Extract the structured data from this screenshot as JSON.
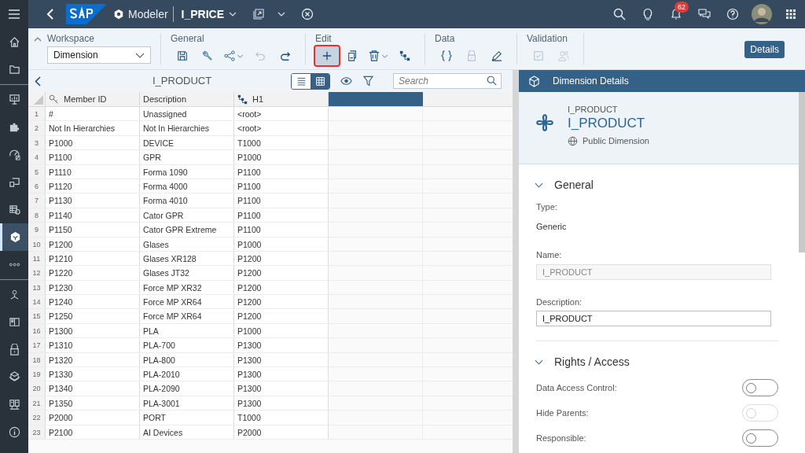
{
  "shell": {
    "product": "Modeler",
    "document": "I_PRICE",
    "notification_count": "62"
  },
  "sidebar": {
    "items": [
      {
        "kind": "home",
        "selected": false
      },
      {
        "kind": "folder",
        "selected": false
      },
      {
        "kind": "board",
        "selected": false
      },
      {
        "kind": "puzzle",
        "selected": false
      },
      {
        "kind": "gauge",
        "selected": false
      },
      {
        "kind": "card",
        "selected": false
      },
      {
        "kind": "table",
        "selected": false
      },
      {
        "kind": "cube",
        "selected": true
      },
      {
        "kind": "more",
        "selected": false
      },
      {
        "kind": "network",
        "selected": false
      },
      {
        "kind": "book",
        "selected": false
      },
      {
        "kind": "lock",
        "selected": false
      },
      {
        "kind": "boxes",
        "selected": false
      },
      {
        "kind": "servers",
        "selected": false
      },
      {
        "kind": "info",
        "selected": false
      }
    ]
  },
  "toolbar": {
    "workspace": {
      "label": "Workspace",
      "value": "Dimension"
    },
    "groups": [
      {
        "label": "General",
        "buttons": [
          {
            "kind": "save",
            "disabled": false,
            "menu": false,
            "selected": false
          },
          {
            "kind": "wrench",
            "disabled": false,
            "menu": false,
            "selected": false
          },
          {
            "kind": "share",
            "disabled": false,
            "menu": true,
            "selected": false
          },
          {
            "kind": "undo",
            "disabled": true,
            "menu": false,
            "selected": false
          },
          {
            "kind": "redo",
            "disabled": false,
            "menu": false,
            "selected": false
          }
        ]
      },
      {
        "label": "Edit",
        "buttons": [
          {
            "kind": "add",
            "disabled": false,
            "menu": false,
            "selected": true
          },
          {
            "kind": "copy",
            "disabled": false,
            "menu": false,
            "selected": false
          },
          {
            "kind": "delete",
            "disabled": false,
            "menu": true,
            "selected": false
          },
          {
            "kind": "hierarchy",
            "disabled": false,
            "menu": false,
            "selected": false
          }
        ]
      },
      {
        "label": "Data",
        "buttons": [
          {
            "kind": "braces",
            "disabled": false,
            "menu": false,
            "selected": false
          },
          {
            "kind": "lock",
            "disabled": true,
            "menu": false,
            "selected": false
          },
          {
            "kind": "pen",
            "disabled": false,
            "menu": false,
            "selected": false
          }
        ]
      },
      {
        "label": "Validation",
        "buttons": [
          {
            "kind": "check",
            "disabled": true,
            "menu": false,
            "selected": false
          },
          {
            "kind": "users",
            "disabled": true,
            "menu": false,
            "selected": false
          }
        ]
      }
    ],
    "details_button": "Details"
  },
  "grid": {
    "title": "I_PRODUCT",
    "views": [
      {
        "kind": "list",
        "selected": false
      },
      {
        "kind": "grid",
        "selected": true
      }
    ],
    "search": {
      "placeholder": "Search"
    },
    "columns": [
      {
        "label": "Member ID",
        "kind": "key"
      },
      {
        "label": "Description",
        "kind": "plain"
      },
      {
        "label": "H1",
        "kind": "hierarchy"
      }
    ],
    "rows": [
      {
        "number": "1",
        "cells": [
          "#",
          "Unassigned",
          "<root>"
        ]
      },
      {
        "number": "2",
        "cells": [
          "Not In Hierarchies",
          "Not In Hierarchies",
          "<root>"
        ]
      },
      {
        "number": "3",
        "cells": [
          "P1000",
          "DEVICE",
          "T1000"
        ]
      },
      {
        "number": "4",
        "cells": [
          "P1100",
          "GPR",
          "P1000"
        ]
      },
      {
        "number": "5",
        "cells": [
          "P1110",
          "Forma 1090",
          "P1100"
        ]
      },
      {
        "number": "6",
        "cells": [
          "P1120",
          "Forma 4000",
          "P1100"
        ]
      },
      {
        "number": "7",
        "cells": [
          "P1130",
          "Forma 4010",
          "P1100"
        ]
      },
      {
        "number": "8",
        "cells": [
          "P1140",
          "Cator GPR",
          "P1100"
        ]
      },
      {
        "number": "9",
        "cells": [
          "P1150",
          "Cator GPR Extreme",
          "P1100"
        ]
      },
      {
        "number": "10",
        "cells": [
          "P1200",
          "Glases",
          "P1000"
        ]
      },
      {
        "number": "11",
        "cells": [
          "P1210",
          "Glases XR128",
          "P1200"
        ]
      },
      {
        "number": "12",
        "cells": [
          "P1220",
          "Glases JT32",
          "P1200"
        ]
      },
      {
        "number": "13",
        "cells": [
          "P1230",
          "Force MP XR32",
          "P1200"
        ]
      },
      {
        "number": "14",
        "cells": [
          "P1240",
          "Force MP XR64",
          "P1200"
        ]
      },
      {
        "number": "15",
        "cells": [
          "P1250",
          "Force MP XR64",
          "P1200"
        ]
      },
      {
        "number": "16",
        "cells": [
          "P1300",
          "PLA",
          "P1000"
        ]
      },
      {
        "number": "17",
        "cells": [
          "P1310",
          "PLA-700",
          "P1300"
        ]
      },
      {
        "number": "18",
        "cells": [
          "P1320",
          "PLA-800",
          "P1300"
        ]
      },
      {
        "number": "19",
        "cells": [
          "P1330",
          "PLA-2010",
          "P1300"
        ]
      },
      {
        "number": "20",
        "cells": [
          "P1340",
          "PLA-2090",
          "P1300"
        ]
      },
      {
        "number": "21",
        "cells": [
          "P1350",
          "PLA-3001",
          "P1300"
        ]
      },
      {
        "number": "22",
        "cells": [
          "P2000",
          "PORT",
          "T1000"
        ]
      },
      {
        "number": "23",
        "cells": [
          "P2100",
          "AI Devices",
          "P2000"
        ]
      }
    ]
  },
  "details": {
    "header": "Dimension Details",
    "subtitle": "I_PRODUCT",
    "title": "I_PRODUCT",
    "visibility": "Public Dimension",
    "sections": [
      {
        "title": "General",
        "expanded": true,
        "fields": [
          {
            "kind": "text",
            "label": "Type:",
            "value": "Generic"
          },
          {
            "kind": "input",
            "label": "Name:",
            "value": "I_PRODUCT",
            "disabled": true
          },
          {
            "kind": "input",
            "label": "Description:",
            "value": "I_PRODUCT",
            "disabled": false
          }
        ]
      },
      {
        "title": "Rights / Access",
        "expanded": true,
        "fields": [
          {
            "kind": "switch",
            "label": "Data Access Control:",
            "on": false,
            "disabled": false
          },
          {
            "kind": "switch",
            "label": "Hide Parents:",
            "on": false,
            "disabled": true
          },
          {
            "kind": "switch",
            "label": "Responsible:",
            "on": false,
            "disabled": false
          }
        ]
      }
    ]
  }
}
